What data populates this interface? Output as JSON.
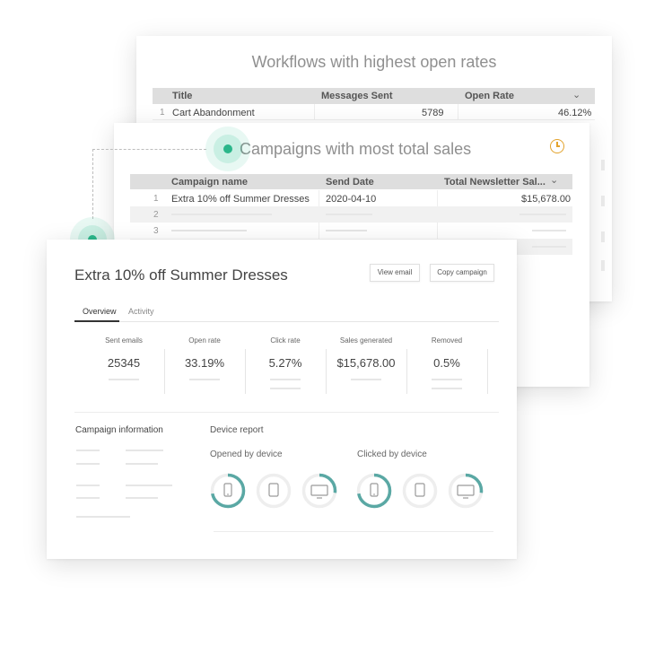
{
  "workflows_card": {
    "title": "Workflows with highest open rates",
    "columns": [
      "Title",
      "Messages Sent",
      "Open Rate"
    ],
    "rows": [
      {
        "num": "1",
        "title": "Cart Abandonment",
        "sent": "5789",
        "rate": "46.12%"
      }
    ],
    "icons": {
      "sort": "chevron-down-icon"
    }
  },
  "campaigns_card": {
    "title": "Campaigns with most total sales",
    "columns": [
      "Campaign name",
      "Send Date",
      "Total Newsletter Sal..."
    ],
    "rows": [
      {
        "num": "1",
        "name": "Extra 10% off Summer Dresses",
        "date": "2020-04-10",
        "total": "$15,678.00"
      },
      {
        "num": "2"
      },
      {
        "num": "3"
      }
    ],
    "icons": {
      "clock": "clock-icon",
      "sort": "chevron-down-icon"
    }
  },
  "campaign_detail": {
    "title": "Extra 10% off Summer Dresses",
    "buttons": {
      "view_email": "View email",
      "copy_campaign": "Copy campaign"
    },
    "tabs": [
      "Overview",
      "Activity"
    ],
    "active_tab": "Overview",
    "stats": [
      {
        "label": "Sent emails",
        "value": "25345"
      },
      {
        "label": "Open rate",
        "value": "33.19%"
      },
      {
        "label": "Click rate",
        "value": "5.27%"
      },
      {
        "label": "Sales generated",
        "value": "$15,678.00"
      },
      {
        "label": "Removed",
        "value": "0.5%"
      }
    ],
    "campaign_info_title": "Campaign information",
    "device_report": {
      "title": "Device report",
      "opened": {
        "title": "Opened by device",
        "mobile": 0.72,
        "tablet": 0.0,
        "desktop": 0.27
      },
      "clicked": {
        "title": "Clicked by device",
        "mobile": 0.72,
        "tablet": 0.0,
        "desktop": 0.27
      }
    }
  },
  "colors": {
    "accent": "#2bb68a",
    "donut": "#5aa8a4",
    "donut_track": "#eeeeee",
    "clock": "#e3a32d"
  }
}
